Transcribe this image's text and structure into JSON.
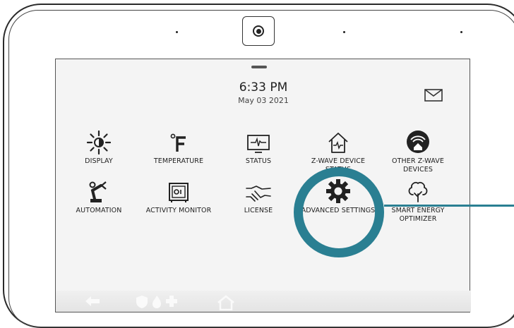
{
  "status": {
    "time": "6:33 PM",
    "date": "May 03 2021"
  },
  "grid": {
    "row1": [
      {
        "label": "DISPLAY",
        "icon": "brightness-icon"
      },
      {
        "label": "TEMPERATURE",
        "icon": "temperature-icon"
      },
      {
        "label": "STATUS",
        "icon": "status-icon"
      },
      {
        "label": "Z-WAVE DEVICE STATUS",
        "icon": "house-heartbeat-icon"
      },
      {
        "label": "OTHER Z-WAVE DEVICES",
        "icon": "zwave-house-icon"
      }
    ],
    "row2": [
      {
        "label": "AUTOMATION",
        "icon": "robot-arm-icon"
      },
      {
        "label": "ACTIVITY MONITOR",
        "icon": "safe-icon"
      },
      {
        "label": "LICENSE",
        "icon": "handshake-icon"
      },
      {
        "label": "ADVANCED SETTINGS",
        "icon": "gear-icon"
      },
      {
        "label": "SMART ENERGY OPTIMIZER",
        "icon": "tree-icon"
      }
    ]
  },
  "colors": {
    "highlight": "#2a7f92",
    "frame": "#2a2a2a"
  }
}
